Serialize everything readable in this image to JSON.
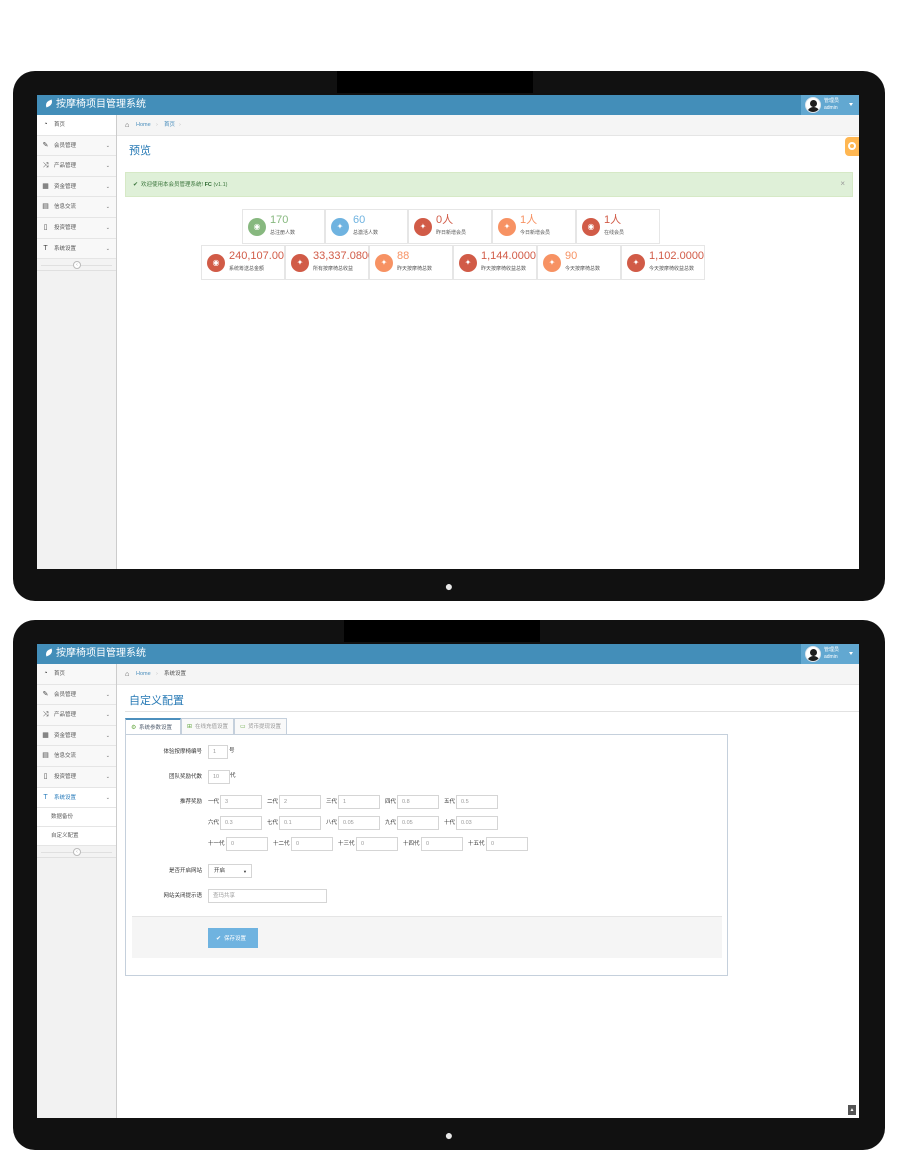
{
  "app": {
    "title": "按摩椅项目管理系统",
    "user_welcome": "管理员",
    "user_name": "admin"
  },
  "sidebar": {
    "items": [
      {
        "label": "首页",
        "icon": "dashboard-icon"
      },
      {
        "label": "会员管理",
        "icon": "edit-icon"
      },
      {
        "label": "产品管理",
        "icon": "random-icon"
      },
      {
        "label": "资金管理",
        "icon": "calendar-icon"
      },
      {
        "label": "信息交流",
        "icon": "list-alt-icon"
      },
      {
        "label": "投资管理",
        "icon": "file-icon"
      },
      {
        "label": "系统设置",
        "icon": "text-width-icon"
      }
    ],
    "sub_items": [
      "数据备份",
      "自定义配置"
    ]
  },
  "screen1": {
    "breadcrumb": {
      "home": "Home",
      "current": "首页"
    },
    "page_title": "预览",
    "alert": {
      "text": "欢迎使用本会员管理系统!",
      "brand": "FC",
      "version": "(v1.1)",
      "close": "×"
    },
    "stats_row1": [
      {
        "value": "170",
        "label": "总注册人数",
        "color": "#87b87f"
      },
      {
        "value": "60",
        "label": "总激活人数",
        "color": "#6fb3e0"
      },
      {
        "value": "0人",
        "label": "昨日新增会员",
        "color": "#d15b47"
      },
      {
        "value": "1人",
        "label": "今日新增会员",
        "color": "#f79263"
      },
      {
        "value": "1人",
        "label": "在线会员",
        "color": "#d15b47"
      }
    ],
    "stats_row2": [
      {
        "value": "240,107.00",
        "label": "系统筹送总金额",
        "color": "#d15b47"
      },
      {
        "value": "33,337.0800",
        "label": "所有按摩椅总收益",
        "color": "#d15b47"
      },
      {
        "value": "88",
        "label": "昨天按摩椅总数",
        "color": "#f79263"
      },
      {
        "value": "1,144.0000",
        "label": "昨天按摩椅收益总数",
        "color": "#d15b47"
      },
      {
        "value": "90",
        "label": "今天按摩椅总数",
        "color": "#f79263"
      },
      {
        "value": "1,102.0000",
        "label": "今天按摩椅收益总数",
        "color": "#d15b47"
      }
    ]
  },
  "screen2": {
    "breadcrumb": {
      "home": "Home",
      "current": "系统设置"
    },
    "page_title": "自定义配置",
    "tabs": [
      {
        "label": "系统参数设置",
        "icon": "cogs-icon",
        "color": "#69aa46"
      },
      {
        "label": "在线充值设置",
        "icon": "plus-square-icon",
        "color": "#69aa46"
      },
      {
        "label": "货币提现设置",
        "icon": "credit-card-icon",
        "color": "#69aa46"
      }
    ],
    "form": {
      "chair_no_label": "体验按摩椅编号",
      "chair_no_value": "1",
      "chair_no_unit": "号",
      "team_label": "团队奖励代数",
      "team_value": "10",
      "team_unit": "代",
      "rec_label": "推荐奖励",
      "generations": [
        [
          {
            "label": "一代",
            "value": "3"
          },
          {
            "label": "二代",
            "value": "2"
          },
          {
            "label": "三代",
            "value": "1"
          },
          {
            "label": "四代",
            "value": "0.8"
          },
          {
            "label": "五代",
            "value": "0.5"
          }
        ],
        [
          {
            "label": "六代",
            "value": "0.3"
          },
          {
            "label": "七代",
            "value": "0.1"
          },
          {
            "label": "八代",
            "value": "0.05"
          },
          {
            "label": "九代",
            "value": "0.05"
          },
          {
            "label": "十代",
            "value": "0.03"
          }
        ],
        [
          {
            "label": "十一代",
            "value": "0"
          },
          {
            "label": "十二代",
            "value": "0"
          },
          {
            "label": "十三代",
            "value": "0"
          },
          {
            "label": "十四代",
            "value": "0"
          },
          {
            "label": "十五代",
            "value": "0"
          }
        ]
      ],
      "site_open_label": "是否开启网站",
      "site_open_value": "开启",
      "close_tip_label": "网站关闭提示语",
      "close_tip_value": "查玛共享",
      "save_label": "保存设置"
    }
  },
  "colors": {
    "navbar": "#438eb9",
    "alert_bg": "#dff0d8",
    "save_button": "#6fb3e0"
  }
}
